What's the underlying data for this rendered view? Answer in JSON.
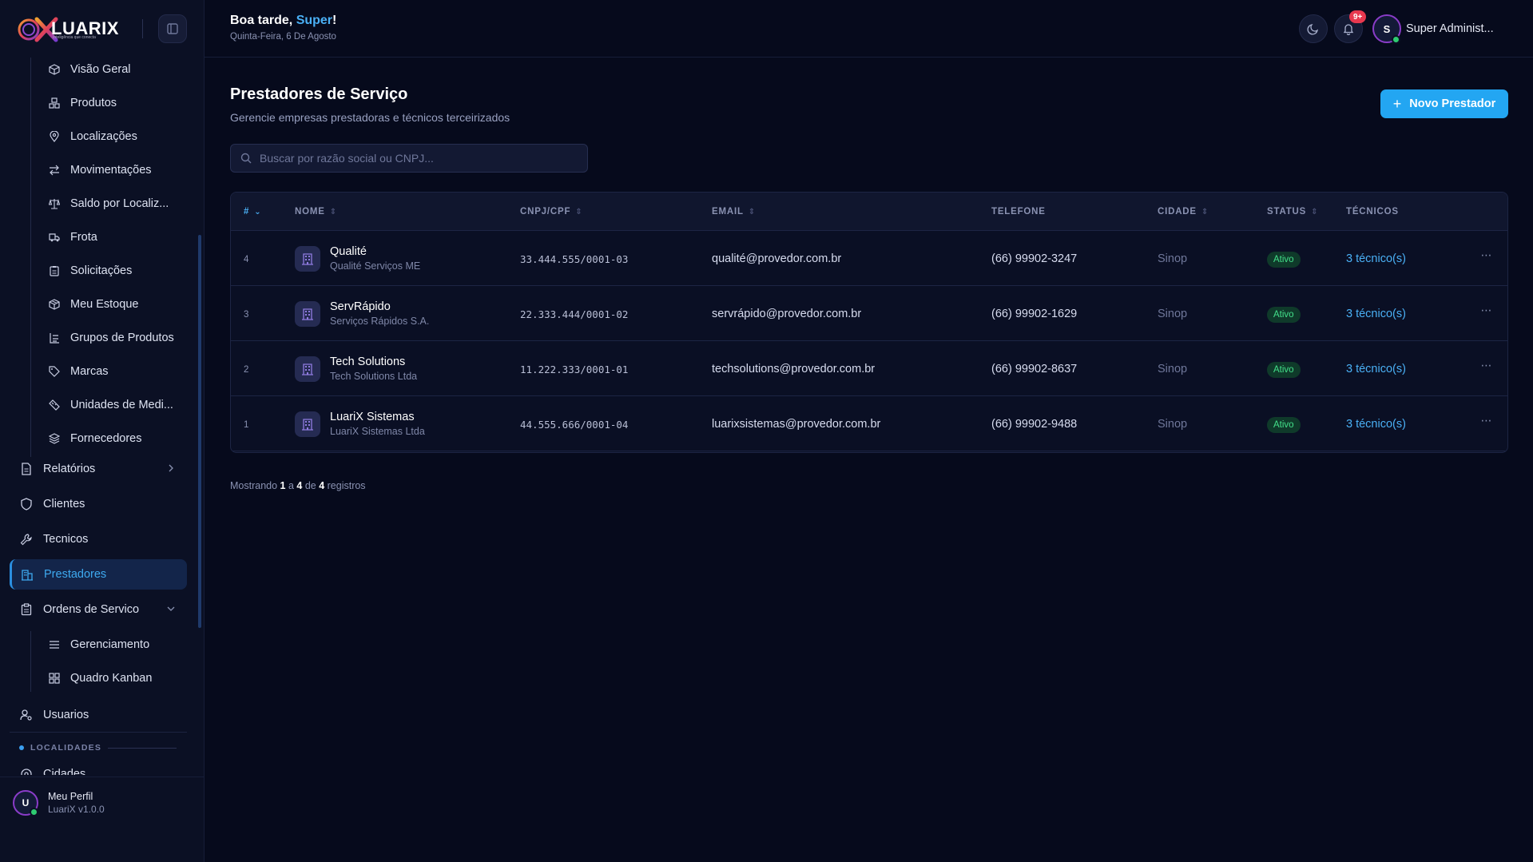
{
  "app": {
    "logo_text": "LUARIX",
    "logo_tagline": "Inteligência que conecta"
  },
  "header": {
    "greeting_prefix": "Boa tarde, ",
    "greeting_name": "Super",
    "greeting_suffix": "!",
    "date": "Quinta-Feira, 6 De Agosto",
    "notification_count": "9+",
    "user_initial": "S",
    "user_name": "Super Administ..."
  },
  "sidebar": {
    "sub_items": [
      {
        "label": "Visão Geral",
        "icon": "box-icon"
      },
      {
        "label": "Produtos",
        "icon": "boxes-icon"
      },
      {
        "label": "Localizações",
        "icon": "map-pin-icon"
      },
      {
        "label": "Movimentações",
        "icon": "arrows-swap-icon"
      },
      {
        "label": "Saldo por Localiz...",
        "icon": "scale-icon"
      },
      {
        "label": "Frota",
        "icon": "truck-icon"
      },
      {
        "label": "Solicitações",
        "icon": "clipboard-icon"
      },
      {
        "label": "Meu Estoque",
        "icon": "package-icon"
      },
      {
        "label": "Grupos de Produtos",
        "icon": "grid-list-icon"
      },
      {
        "label": "Marcas",
        "icon": "tag-icon"
      },
      {
        "label": "Unidades de Medi...",
        "icon": "ruler-icon"
      },
      {
        "label": "Fornecedores",
        "icon": "layers-icon"
      }
    ],
    "nav_items": [
      {
        "label": "Relatórios",
        "icon": "report-icon"
      },
      {
        "label": "Clientes",
        "icon": "shield-icon"
      },
      {
        "label": "Tecnicos",
        "icon": "wrench-icon"
      },
      {
        "label": "Prestadores",
        "icon": "building-icon"
      },
      {
        "label": "Ordens de Servico",
        "icon": "clipboard-list-icon"
      }
    ],
    "os_sub_items": [
      {
        "label": "Gerenciamento",
        "icon": "menu-icon"
      },
      {
        "label": "Quadro Kanban",
        "icon": "kanban-icon"
      }
    ],
    "usuarios_label": "Usuarios",
    "section_label": "LOCALIDADES",
    "cidades_label": "Cidades",
    "profile": {
      "initial": "U",
      "name": "Meu Perfil",
      "version": "LuariX v1.0.0"
    }
  },
  "main": {
    "title": "Prestadores de Serviço",
    "subtitle": "Gerencie empresas prestadoras e técnicos terceirizados",
    "new_button": "Novo Prestador",
    "search_placeholder": "Buscar por razão social ou CNPJ...",
    "columns": [
      "#",
      "NOME",
      "CNPJ/CPF",
      "EMAIL",
      "TELEFONE",
      "CIDADE",
      "STATUS",
      "TÉCNICOS"
    ],
    "rows": [
      {
        "id": "4",
        "name": "Qualité",
        "company": "Qualité Serviços ME",
        "cnpj": "33.444.555/0001-03",
        "email": "qualité@provedor.com.br",
        "phone": "(66) 99902-3247",
        "city": "Sinop",
        "status": "Ativo",
        "tech": "3 técnico(s)"
      },
      {
        "id": "3",
        "name": "ServRápido",
        "company": "Serviços Rápidos S.A.",
        "cnpj": "22.333.444/0001-02",
        "email": "servrápido@provedor.com.br",
        "phone": "(66) 99902-1629",
        "city": "Sinop",
        "status": "Ativo",
        "tech": "3 técnico(s)"
      },
      {
        "id": "2",
        "name": "Tech Solutions",
        "company": "Tech Solutions Ltda",
        "cnpj": "11.222.333/0001-01",
        "email": "techsolutions@provedor.com.br",
        "phone": "(66) 99902-8637",
        "city": "Sinop",
        "status": "Ativo",
        "tech": "3 técnico(s)"
      },
      {
        "id": "1",
        "name": "LuariX Sistemas",
        "company": "LuariX Sistemas Ltda",
        "cnpj": "44.555.666/0001-04",
        "email": "luarixsistemas@provedor.com.br",
        "phone": "(66) 99902-9488",
        "city": "Sinop",
        "status": "Ativo",
        "tech": "3 técnico(s)"
      }
    ],
    "footer": {
      "prefix": "Mostrando ",
      "from": "1",
      "sep1": " a ",
      "to": "4",
      "sep2": " de ",
      "total": "4",
      "suffix": " registros"
    }
  },
  "colors": {
    "accent": "#23a6f2",
    "active_bg": "#13254a",
    "status_green": "#43e08a",
    "badge_red": "#e8384f"
  }
}
